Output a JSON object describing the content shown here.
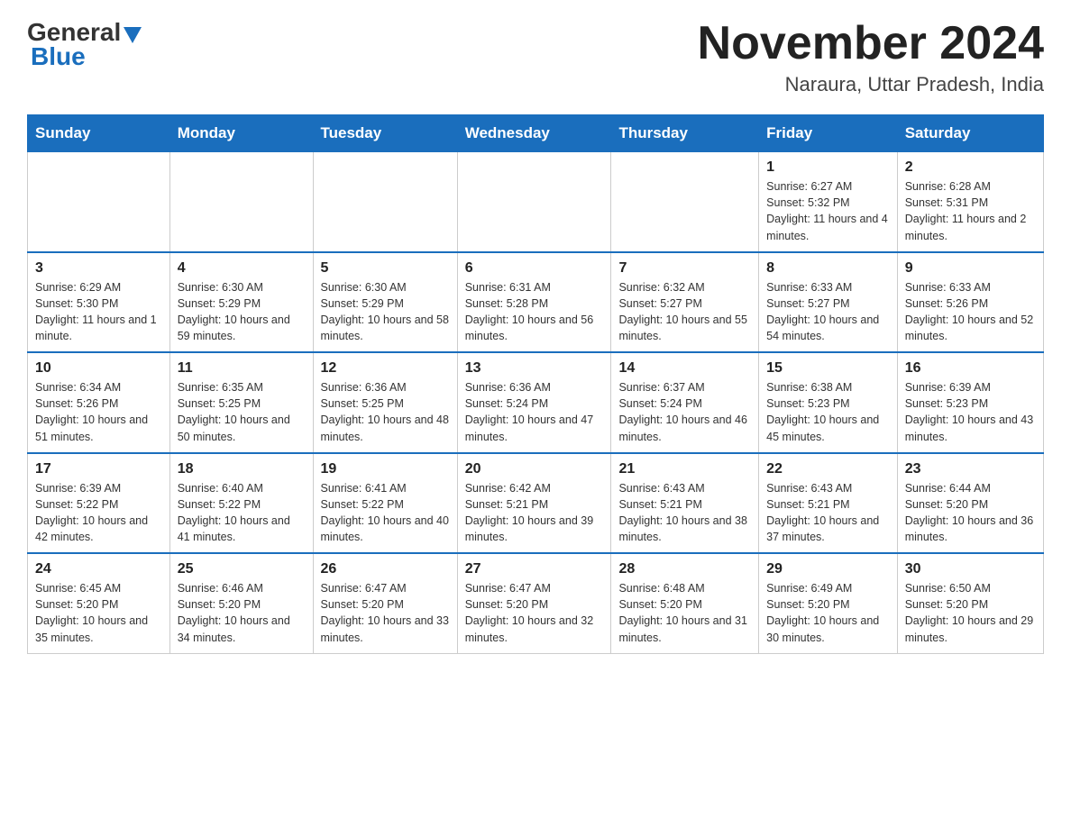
{
  "header": {
    "logo_general": "General",
    "logo_blue": "Blue",
    "month_title": "November 2024",
    "location": "Naraura, Uttar Pradesh, India"
  },
  "days_of_week": [
    "Sunday",
    "Monday",
    "Tuesday",
    "Wednesday",
    "Thursday",
    "Friday",
    "Saturday"
  ],
  "weeks": [
    [
      {
        "day": "",
        "info": ""
      },
      {
        "day": "",
        "info": ""
      },
      {
        "day": "",
        "info": ""
      },
      {
        "day": "",
        "info": ""
      },
      {
        "day": "",
        "info": ""
      },
      {
        "day": "1",
        "info": "Sunrise: 6:27 AM\nSunset: 5:32 PM\nDaylight: 11 hours and 4 minutes."
      },
      {
        "day": "2",
        "info": "Sunrise: 6:28 AM\nSunset: 5:31 PM\nDaylight: 11 hours and 2 minutes."
      }
    ],
    [
      {
        "day": "3",
        "info": "Sunrise: 6:29 AM\nSunset: 5:30 PM\nDaylight: 11 hours and 1 minute."
      },
      {
        "day": "4",
        "info": "Sunrise: 6:30 AM\nSunset: 5:29 PM\nDaylight: 10 hours and 59 minutes."
      },
      {
        "day": "5",
        "info": "Sunrise: 6:30 AM\nSunset: 5:29 PM\nDaylight: 10 hours and 58 minutes."
      },
      {
        "day": "6",
        "info": "Sunrise: 6:31 AM\nSunset: 5:28 PM\nDaylight: 10 hours and 56 minutes."
      },
      {
        "day": "7",
        "info": "Sunrise: 6:32 AM\nSunset: 5:27 PM\nDaylight: 10 hours and 55 minutes."
      },
      {
        "day": "8",
        "info": "Sunrise: 6:33 AM\nSunset: 5:27 PM\nDaylight: 10 hours and 54 minutes."
      },
      {
        "day": "9",
        "info": "Sunrise: 6:33 AM\nSunset: 5:26 PM\nDaylight: 10 hours and 52 minutes."
      }
    ],
    [
      {
        "day": "10",
        "info": "Sunrise: 6:34 AM\nSunset: 5:26 PM\nDaylight: 10 hours and 51 minutes."
      },
      {
        "day": "11",
        "info": "Sunrise: 6:35 AM\nSunset: 5:25 PM\nDaylight: 10 hours and 50 minutes."
      },
      {
        "day": "12",
        "info": "Sunrise: 6:36 AM\nSunset: 5:25 PM\nDaylight: 10 hours and 48 minutes."
      },
      {
        "day": "13",
        "info": "Sunrise: 6:36 AM\nSunset: 5:24 PM\nDaylight: 10 hours and 47 minutes."
      },
      {
        "day": "14",
        "info": "Sunrise: 6:37 AM\nSunset: 5:24 PM\nDaylight: 10 hours and 46 minutes."
      },
      {
        "day": "15",
        "info": "Sunrise: 6:38 AM\nSunset: 5:23 PM\nDaylight: 10 hours and 45 minutes."
      },
      {
        "day": "16",
        "info": "Sunrise: 6:39 AM\nSunset: 5:23 PM\nDaylight: 10 hours and 43 minutes."
      }
    ],
    [
      {
        "day": "17",
        "info": "Sunrise: 6:39 AM\nSunset: 5:22 PM\nDaylight: 10 hours and 42 minutes."
      },
      {
        "day": "18",
        "info": "Sunrise: 6:40 AM\nSunset: 5:22 PM\nDaylight: 10 hours and 41 minutes."
      },
      {
        "day": "19",
        "info": "Sunrise: 6:41 AM\nSunset: 5:22 PM\nDaylight: 10 hours and 40 minutes."
      },
      {
        "day": "20",
        "info": "Sunrise: 6:42 AM\nSunset: 5:21 PM\nDaylight: 10 hours and 39 minutes."
      },
      {
        "day": "21",
        "info": "Sunrise: 6:43 AM\nSunset: 5:21 PM\nDaylight: 10 hours and 38 minutes."
      },
      {
        "day": "22",
        "info": "Sunrise: 6:43 AM\nSunset: 5:21 PM\nDaylight: 10 hours and 37 minutes."
      },
      {
        "day": "23",
        "info": "Sunrise: 6:44 AM\nSunset: 5:20 PM\nDaylight: 10 hours and 36 minutes."
      }
    ],
    [
      {
        "day": "24",
        "info": "Sunrise: 6:45 AM\nSunset: 5:20 PM\nDaylight: 10 hours and 35 minutes."
      },
      {
        "day": "25",
        "info": "Sunrise: 6:46 AM\nSunset: 5:20 PM\nDaylight: 10 hours and 34 minutes."
      },
      {
        "day": "26",
        "info": "Sunrise: 6:47 AM\nSunset: 5:20 PM\nDaylight: 10 hours and 33 minutes."
      },
      {
        "day": "27",
        "info": "Sunrise: 6:47 AM\nSunset: 5:20 PM\nDaylight: 10 hours and 32 minutes."
      },
      {
        "day": "28",
        "info": "Sunrise: 6:48 AM\nSunset: 5:20 PM\nDaylight: 10 hours and 31 minutes."
      },
      {
        "day": "29",
        "info": "Sunrise: 6:49 AM\nSunset: 5:20 PM\nDaylight: 10 hours and 30 minutes."
      },
      {
        "day": "30",
        "info": "Sunrise: 6:50 AM\nSunset: 5:20 PM\nDaylight: 10 hours and 29 minutes."
      }
    ]
  ]
}
